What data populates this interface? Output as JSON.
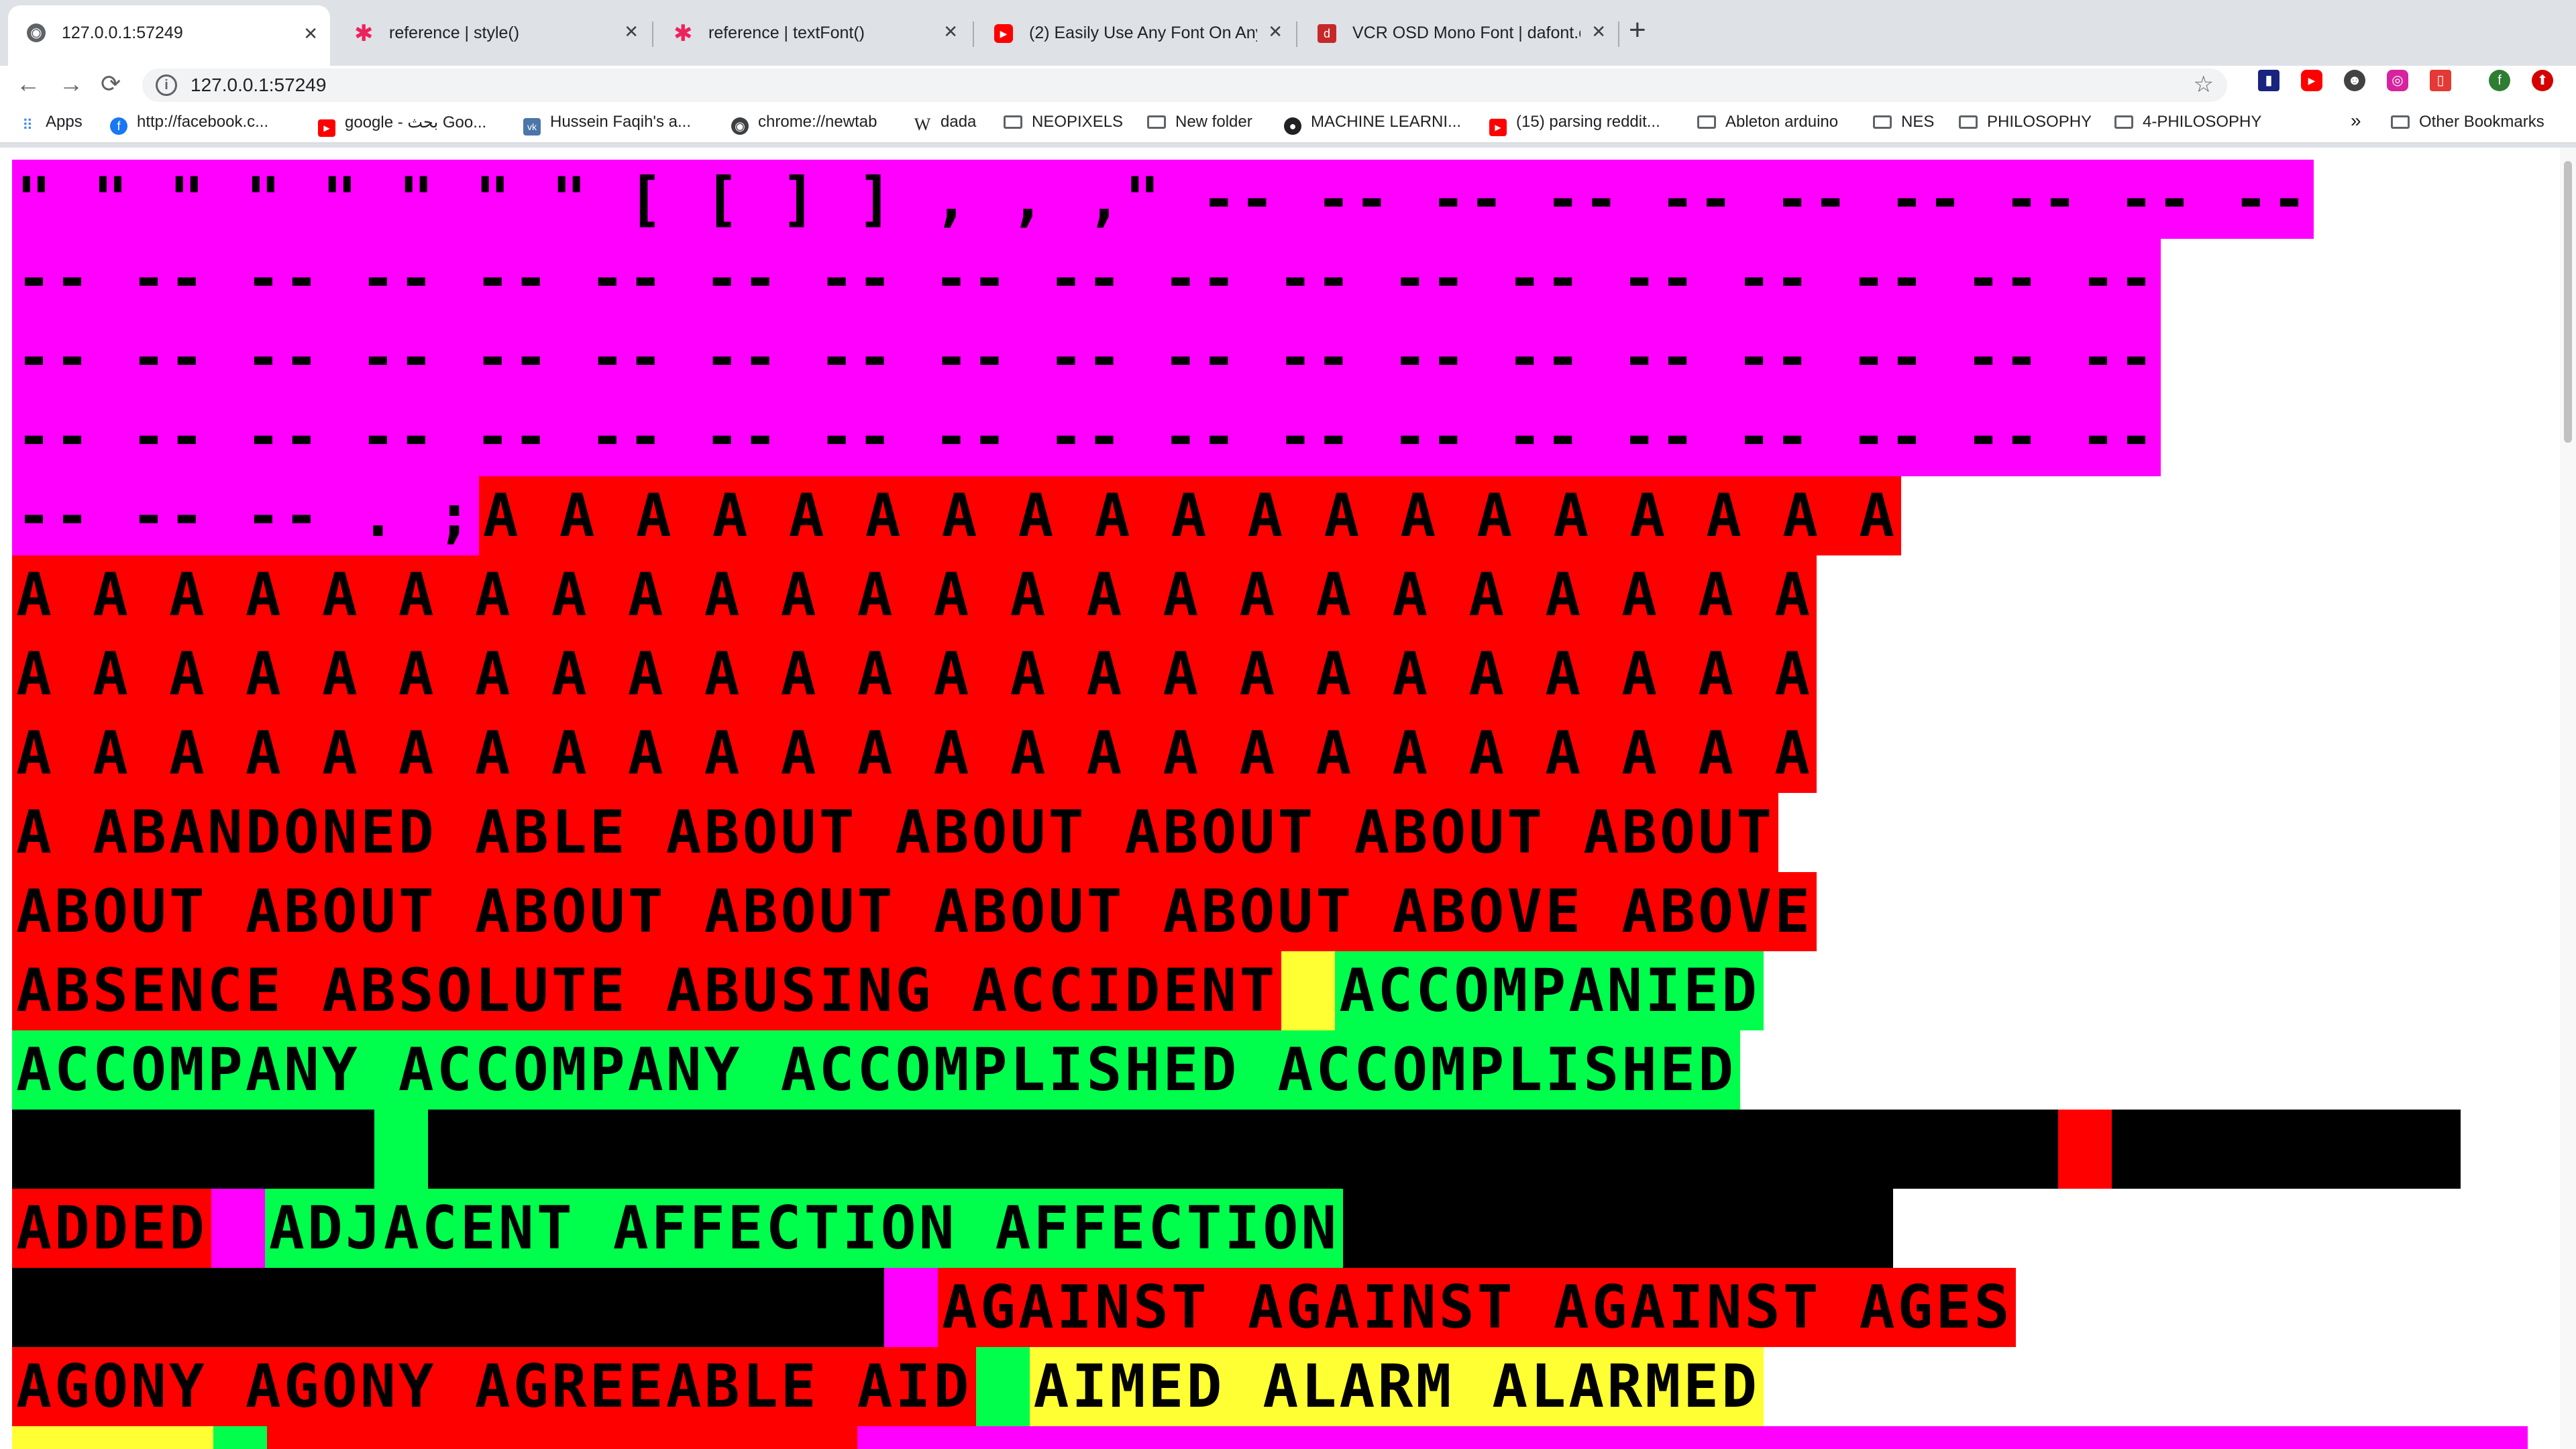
{
  "tabs": [
    {
      "title": "127.0.0.1:57249",
      "icon": "globe-icon",
      "active": true
    },
    {
      "title": "reference | style()",
      "icon": "p5-asterisk-icon"
    },
    {
      "title": "reference | textFont()",
      "icon": "p5-asterisk-icon"
    },
    {
      "title": "(2) Easily Use Any Font On Any",
      "icon": "youtube-icon"
    },
    {
      "title": "VCR OSD Mono Font | dafont.c",
      "icon": "dafont-icon"
    }
  ],
  "toolbar": {
    "url": "127.0.0.1:57249",
    "back_label": "←",
    "forward_label": "→",
    "reload_label": "⟳",
    "star_label": "☆"
  },
  "bookmarks": [
    {
      "label": "Apps",
      "icon": "apps-grid-icon"
    },
    {
      "label": "http://facebook.c...",
      "icon": "facebook-icon"
    },
    {
      "label": "google - بحث Goo...",
      "icon": "youtube-icon"
    },
    {
      "label": "Hussein Faqih's a...",
      "icon": "vk-icon"
    },
    {
      "label": "chrome://newtab",
      "icon": "globe-icon"
    },
    {
      "label": "dada",
      "icon": "wikipedia-icon"
    },
    {
      "label": "NEOPIXELS",
      "icon": "folder-icon"
    },
    {
      "label": "New folder",
      "icon": "folder-icon"
    },
    {
      "label": "MACHINE LEARNI...",
      "icon": "github-icon"
    },
    {
      "label": "(15) parsing reddit...",
      "icon": "youtube-icon"
    },
    {
      "label": "Ableton arduino",
      "icon": "folder-icon"
    },
    {
      "label": "NES",
      "icon": "folder-icon"
    },
    {
      "label": "PHILOSOPHY",
      "icon": "folder-icon"
    },
    {
      "label": "4-PHILOSOPHY",
      "icon": "folder-icon"
    }
  ],
  "bookmarks_overflow": "»",
  "other_bookmarks": "Other Bookmarks",
  "colors": {
    "magenta": "#ff00ff",
    "red": "#ff0000",
    "green": "#00ff4c",
    "yellow": "#ffff33",
    "black": "#000000"
  },
  "canvas_rows": [
    {
      "segments": [
        {
          "text": "\" \" \" \" \" \" \" \" [ [ ] ] , , ,\" -- -- -- -- -- -- -- -- -- --",
          "bg": "magenta"
        }
      ]
    },
    {
      "segments": [
        {
          "text": "-- -- -- -- -- -- -- -- -- -- -- -- -- -- -- -- -- -- --",
          "bg": "magenta"
        }
      ]
    },
    {
      "segments": [
        {
          "text": "-- -- -- -- -- -- -- -- -- -- -- -- -- -- -- -- -- -- --",
          "bg": "magenta"
        }
      ]
    },
    {
      "segments": [
        {
          "text": "-- -- -- -- -- -- -- -- -- -- -- -- -- -- -- -- -- -- --",
          "bg": "magenta"
        }
      ]
    },
    {
      "segments": [
        {
          "text": "-- -- -- . ;",
          "bg": "magenta"
        },
        {
          "text": "A A A A A A A A A A A A A A A A A A A",
          "bg": "red"
        }
      ]
    },
    {
      "segments": [
        {
          "text": "A A A A A A A A A A A A A A A A A A A A A A A A",
          "bg": "red"
        }
      ]
    },
    {
      "segments": [
        {
          "text": "A A A A A A A A A A A A A A A A A A A A A A A A",
          "bg": "red"
        }
      ]
    },
    {
      "segments": [
        {
          "text": "A A A A A A A A A A A A A A A A A A A A A A A A",
          "bg": "red"
        }
      ]
    },
    {
      "segments": [
        {
          "text": "A ABANDONED ABLE ABOUT ABOUT ABOUT ABOUT ABOUT",
          "bg": "red"
        }
      ]
    },
    {
      "segments": [
        {
          "text": "ABOUT ABOUT ABOUT ABOUT ABOUT ABOUT ABOVE ABOVE",
          "bg": "red"
        }
      ]
    },
    {
      "segments": [
        {
          "text": "ABSENCE ABSOLUTE ABUSING ACCIDENT",
          "bg": "red"
        },
        {
          "text": "",
          "bg": "yellow"
        },
        {
          "text": "ACCOMPANIED",
          "bg": "green"
        }
      ]
    },
    {
      "segments": [
        {
          "text": "ACCOMPANY ACCOMPANY ACCOMPLISHED ACCOMPLISHED",
          "bg": "green"
        }
      ]
    },
    {
      "segments": [
        {
          "text": "",
          "bg": "black"
        },
        {
          "text": "",
          "bg": "green"
        },
        {
          "text": "",
          "bg": "black"
        },
        {
          "text": "",
          "bg": "red"
        },
        {
          "text": "",
          "bg": "black"
        }
      ]
    },
    {
      "segments": [
        {
          "text": "ADDED",
          "bg": "red"
        },
        {
          "text": "",
          "bg": "magenta"
        },
        {
          "text": "ADJACENT AFFECTION AFFECTION",
          "bg": "green"
        },
        {
          "text": "",
          "bg": "black"
        }
      ]
    },
    {
      "segments": [
        {
          "text": "",
          "bg": "black"
        },
        {
          "text": "",
          "bg": "magenta"
        },
        {
          "text": "AGAINST AGAINST AGAINST AGES",
          "bg": "red"
        }
      ]
    },
    {
      "segments": [
        {
          "text": "AGONY AGONY AGREEABLE AID",
          "bg": "red"
        },
        {
          "text": "",
          "bg": "green"
        },
        {
          "text": "AIMED ALARM ALARMED",
          "bg": "yellow"
        }
      ]
    },
    {
      "segments": [
        {
          "text": "",
          "bg": "yellow"
        },
        {
          "text": "",
          "bg": "green"
        },
        {
          "text": "",
          "bg": "red"
        },
        {
          "text": "",
          "bg": "magenta"
        }
      ]
    }
  ]
}
